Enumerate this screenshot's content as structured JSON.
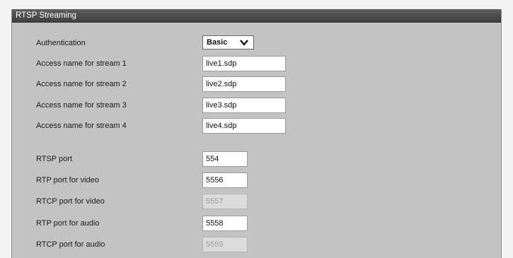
{
  "section": {
    "title": "RTSP Streaming"
  },
  "authentication": {
    "label": "Authentication",
    "value": "Basic",
    "icon": "chevron-down-icon"
  },
  "streams": [
    {
      "label": "Access name for stream 1",
      "value": "live1.sdp"
    },
    {
      "label": "Access name for stream 2",
      "value": "live2.sdp"
    },
    {
      "label": "Access name for stream 3",
      "value": "live3.sdp"
    },
    {
      "label": "Access name for stream 4",
      "value": "live4.sdp"
    }
  ],
  "ports": [
    {
      "label": "RTSP port",
      "value": "554",
      "disabled": false
    },
    {
      "label": "RTP port for video",
      "value": "5556",
      "disabled": false
    },
    {
      "label": "RTCP port for video",
      "value": "5557",
      "disabled": true
    },
    {
      "label": "RTP port for audio",
      "value": "5558",
      "disabled": false
    },
    {
      "label": "RTCP port for audio",
      "value": "5559",
      "disabled": true
    }
  ]
}
